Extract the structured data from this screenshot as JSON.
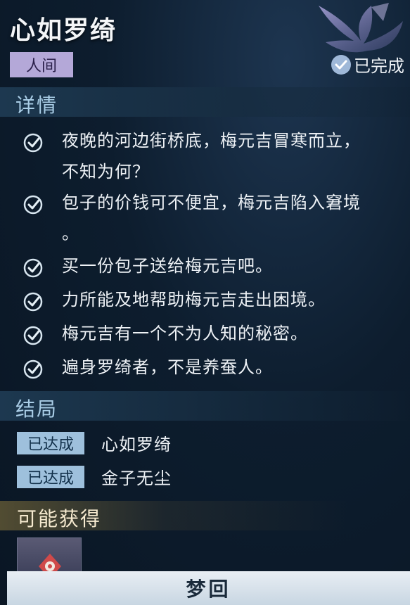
{
  "header": {
    "title": "心如罗绮",
    "tag": "人间",
    "status": "已完成"
  },
  "details": {
    "heading": "详情",
    "items": [
      {
        "lines": [
          "夜晚的河边街桥底，梅元吉冒寒而立，",
          "不知为何？"
        ]
      },
      {
        "lines": [
          "包子的价钱可不便宜，梅元吉陷入窘境",
          "。"
        ]
      },
      {
        "lines": [
          "买一份包子送给梅元吉吧。"
        ]
      },
      {
        "lines": [
          "力所能及地帮助梅元吉走出困境。"
        ]
      },
      {
        "lines": [
          "梅元吉有一个不为人知的秘密。"
        ]
      },
      {
        "lines": [
          "遍身罗绮者，不是养蚕人。"
        ]
      }
    ]
  },
  "endings": {
    "heading": "结局",
    "items": [
      {
        "badge": "已达成",
        "name": "心如罗绮"
      },
      {
        "badge": "已达成",
        "name": "金子无尘"
      }
    ]
  },
  "rewards": {
    "heading": "可能获得"
  },
  "footer": {
    "button_label": "梦回"
  },
  "colors": {
    "tag_bg": "#b4a8d8",
    "badge_bg": "#9ec0dc",
    "section_title": "#a9cde6"
  }
}
